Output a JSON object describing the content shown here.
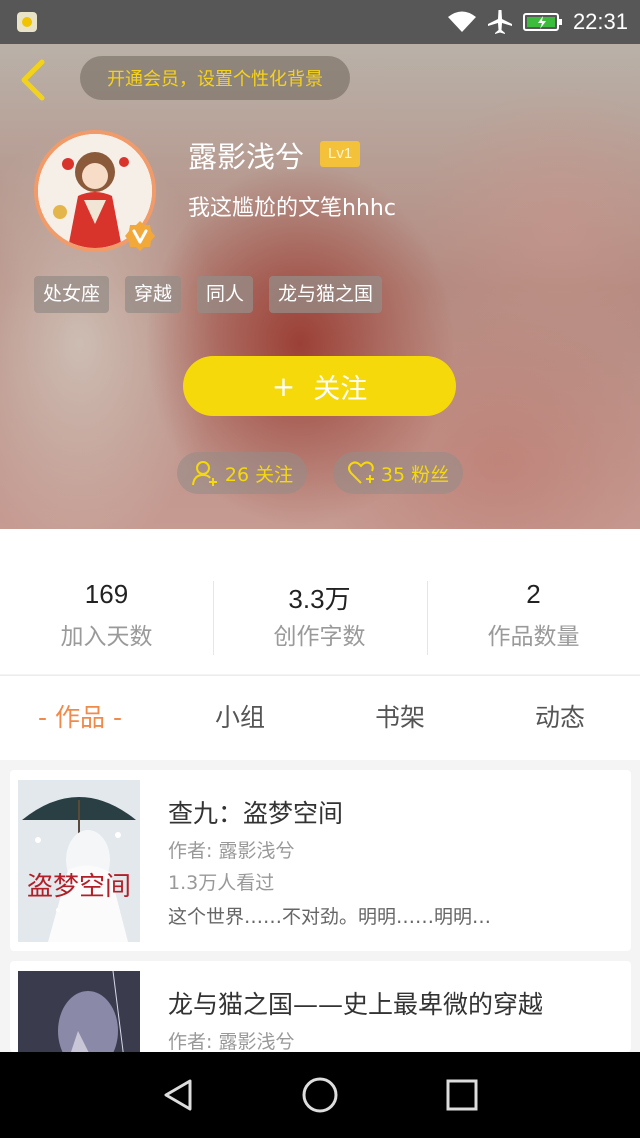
{
  "status_bar": {
    "time": "22:31",
    "icons": [
      "app-notification-icon",
      "wifi-icon",
      "airplane-icon",
      "battery-icon"
    ]
  },
  "header": {
    "vip_banner": "开通会员，设置个性化背景",
    "username": "露影浅兮",
    "level": "Lv1",
    "signature": "我这尴尬的文笔hhhc",
    "tags": [
      "处女座",
      "穿越",
      "同人",
      "龙与猫之国"
    ],
    "follow_button": {
      "plus": "+",
      "label": "关注"
    },
    "following_count": "26 关注",
    "fans_count": "35 粉丝"
  },
  "stats": [
    {
      "value": "169",
      "label": "加入天数"
    },
    {
      "value": "3.3万",
      "label": "创作字数"
    },
    {
      "value": "2",
      "label": "作品数量"
    }
  ],
  "tabs": [
    "- 作品 -",
    "小组",
    "书架",
    "动态"
  ],
  "works": [
    {
      "title": "查九：盗梦空间",
      "author": "作者: 露影浅兮",
      "views": "1.3万人看过",
      "summary": "这个世界……不对劲。明明……明明…",
      "cover_text": "盗梦空间"
    },
    {
      "title": "龙与猫之国——史上最卑微的穿越",
      "author": "作者: 露影浅兮"
    }
  ],
  "colors": {
    "accent": "#f08a4b",
    "follow_yellow": "#f5d90a",
    "level_badge": "#f3c13a",
    "avatar_border": "#f29b6a"
  }
}
